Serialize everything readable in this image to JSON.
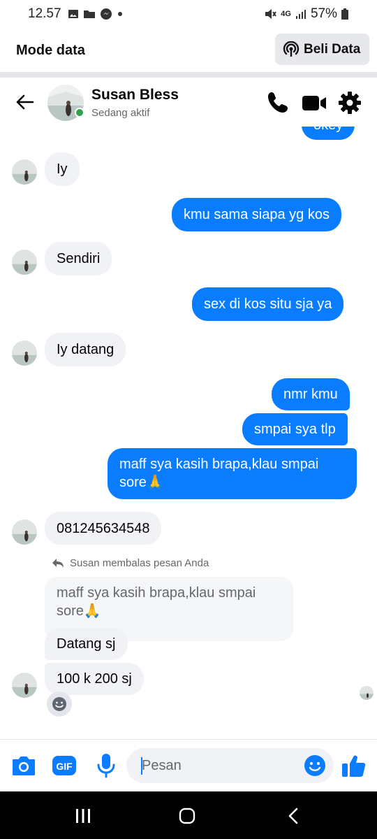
{
  "status_bar": {
    "time": "12.57",
    "network": "4G",
    "battery": "57%"
  },
  "data_banner": {
    "title": "Mode data",
    "button_label": "Beli Data"
  },
  "header": {
    "contact_name": "Susan Bless",
    "status": "Sedang aktif"
  },
  "messages": {
    "m0": "okey",
    "m1": "Iy",
    "m2": "kmu sama siapa yg kos",
    "m3": "Sendiri",
    "m4": "sex di kos situ sja ya",
    "m5": "Iy datang",
    "m6": "nmr kmu",
    "m7": "smpai sya tlp",
    "m8": "maff sya kasih brapa,klau smpai sore🙏",
    "m9": "081245634548",
    "reply_note": "Susan membalas pesan Anda",
    "m10": "maff sya kasih brapa,klau smpai sore🙏",
    "m11": "Datang sj",
    "m12": "100 k 200 sj"
  },
  "composer": {
    "placeholder": "Pesan"
  },
  "colors": {
    "accent": "#0a7cff",
    "incoming_bubble": "#f0f2f5",
    "online": "#31a24c"
  },
  "icons": [
    "back-icon",
    "phone-icon",
    "video-icon",
    "gear-icon",
    "camera-icon",
    "gif-icon",
    "mic-icon",
    "emoji-icon",
    "like-icon",
    "reply-icon"
  ]
}
